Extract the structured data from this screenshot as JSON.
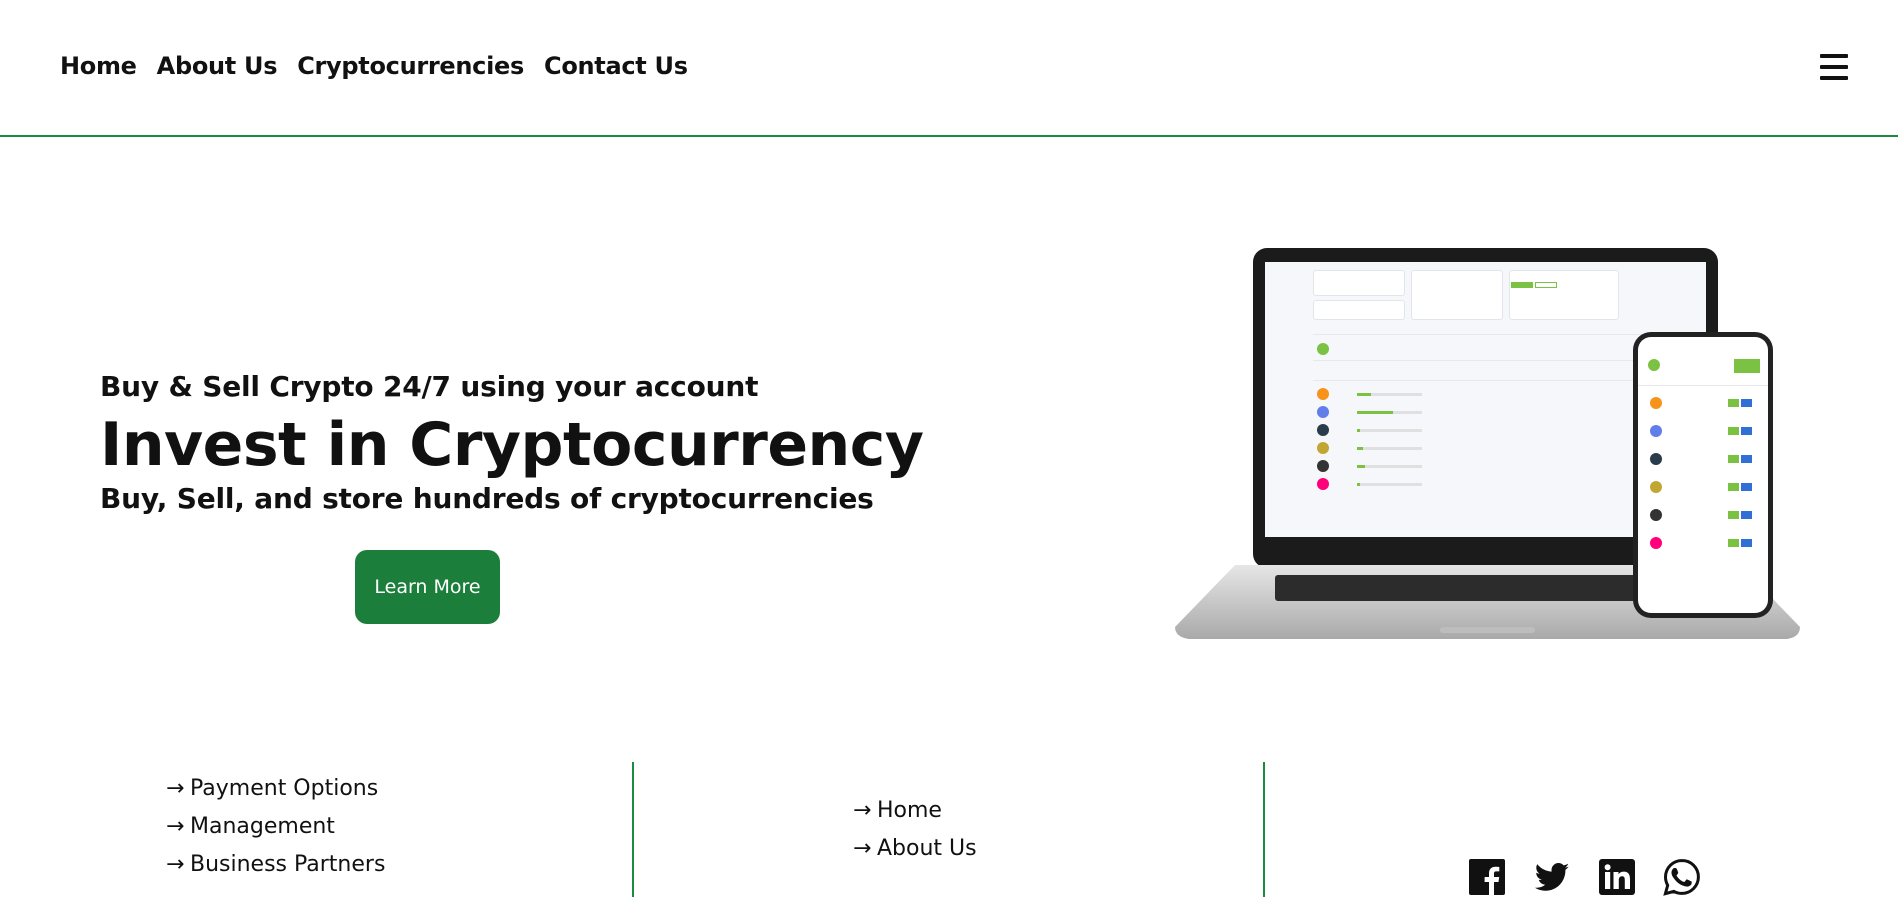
{
  "nav": {
    "links": [
      {
        "label": "Home"
      },
      {
        "label": "About Us"
      },
      {
        "label": "Cryptocurrencies"
      },
      {
        "label": "Contact Us"
      }
    ],
    "menu_icon": "hamburger-menu-icon"
  },
  "hero": {
    "subtitle": "Buy & Sell Crypto 24/7 using your account",
    "title": "Invest in Cryptocurrency",
    "description": "Buy, Sell, and store hundreds of cryptocurrencies",
    "cta_label": "Learn More",
    "image": "laptop-and-phone-dashboard-image"
  },
  "footer": {
    "col1_links": [
      {
        "label": "Payment Options"
      },
      {
        "label": "Management"
      },
      {
        "label": "Business Partners"
      }
    ],
    "col2_links": [
      {
        "label": "Home"
      },
      {
        "label": "About Us"
      }
    ],
    "social": [
      "facebook-icon",
      "twitter-icon",
      "linkedin-icon",
      "whatsapp-icon"
    ]
  },
  "colors": {
    "accent": "#1e8a3e",
    "button": "#1b7f3b"
  }
}
